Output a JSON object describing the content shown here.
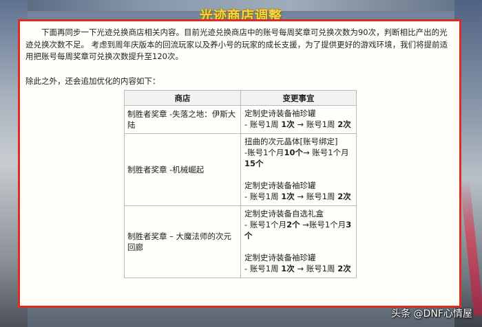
{
  "title": "光迹商店调整",
  "paragraph_1": "下面再同步一下光迹兑换商店相关内容。目前光迹兑换商店中的账号每周奖章可兑换次数为90次，判断相比产出的光迹兑换次数不足。 考虑到周年庆版本的回流玩家以及养小号的玩家的成长支援，为了提供更好的游戏环境，我们将提前适用把账号每周奖章可兑换次数提升至120次。",
  "paragraph_2": "除此之外，还会追加优化的内容如下：",
  "table": {
    "headers": [
      "商店",
      "变更事宜"
    ],
    "rows": [
      {
        "shop": "制胜者奖章 -失落之地：伊斯大陆",
        "changes": [
          {
            "item": "定制史诗装备袖珍罐",
            "line_prefix": "- 账号1周 ",
            "from": "1次",
            "arrow": " → 账号1周 ",
            "to": "2次"
          }
        ]
      },
      {
        "shop": "制胜者奖章 -机械崛起",
        "changes": [
          {
            "item": "扭曲的次元晶体[账号绑定]",
            "line_prefix": "-账号1个月",
            "from": "10个",
            "arrow": "→ 账号1个月",
            "to": "15个"
          },
          {
            "item": "定制史诗装备袖珍罐",
            "line_prefix": "- 账号1周 ",
            "from": "1次",
            "arrow": " → 账号1周 ",
            "to": "2次"
          }
        ]
      },
      {
        "shop": "制胜者奖章 – 大魔法师的次元回廊",
        "changes": [
          {
            "item": "定制史诗装备自选礼盒",
            "line_prefix": "- 账号1个月",
            "from": "2个",
            "arrow": " →账号1个月",
            "to": "3个"
          },
          {
            "item": "定制史诗装备袖珍罐",
            "line_prefix": "- 账号1周 ",
            "from": "1次",
            "arrow": " → 账号1周 ",
            "to": "2次"
          }
        ]
      }
    ]
  },
  "watermark": "头条 @DNF心情屋"
}
